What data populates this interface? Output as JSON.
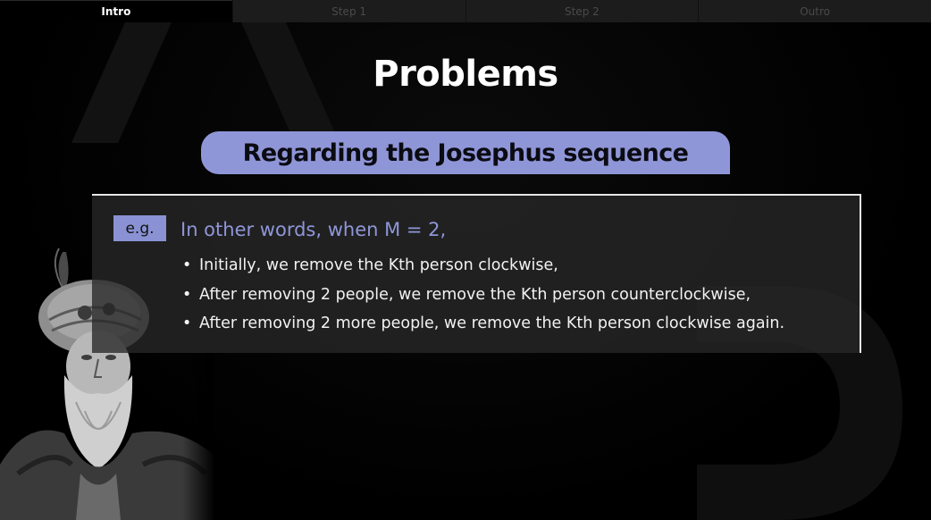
{
  "tabs": [
    {
      "label": "Intro",
      "active": true
    },
    {
      "label": "Step 1",
      "active": false
    },
    {
      "label": "Step 2",
      "active": false
    },
    {
      "label": "Outro",
      "active": false
    }
  ],
  "slide": {
    "title": "Problems",
    "subtitle": "Regarding the Josephus sequence",
    "example": {
      "badge": "e.g.",
      "heading": "In other words, when M = 2,",
      "bullets": [
        "Initially, we remove the Kth person clockwise,",
        "After removing 2 people, we remove the Kth person counterclockwise,",
        "After removing 2 more people, we remove the Kth person clockwise again."
      ]
    }
  },
  "colors": {
    "accent": "#8f96d8",
    "background": "#000000",
    "tab_inactive": "#1c1c1c",
    "text": "#f2f2f2"
  },
  "icons": {
    "portrait": "josephus-portrait-illustration"
  }
}
